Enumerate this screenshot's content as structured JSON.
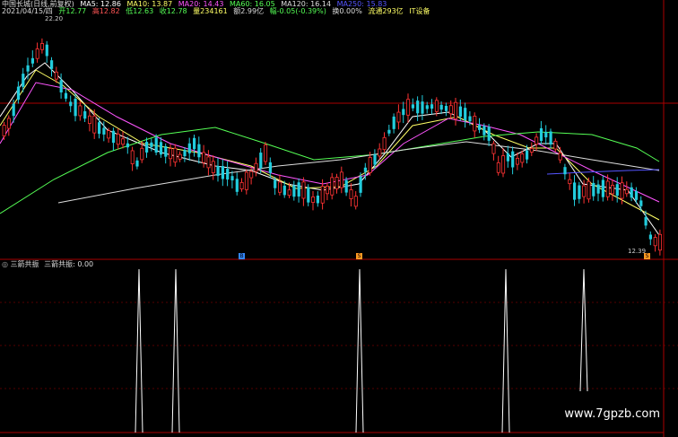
{
  "header": {
    "title": "中国长城(日线,前复权)",
    "ma": [
      {
        "label": "MA5: 12.86",
        "color": "#ffffff"
      },
      {
        "label": "MA10: 13.87",
        "color": "#ffff66"
      },
      {
        "label": "MA20: 14.43",
        "color": "#ff55ff"
      },
      {
        "label": "MA60: 16.05",
        "color": "#55ff55"
      },
      {
        "label": "MA120: 16.14",
        "color": "#dddddd"
      },
      {
        "label": "MA250: 15.83",
        "color": "#5555ff"
      }
    ],
    "info": [
      {
        "label": "2021/04/15/四",
        "color": "#dddddd"
      },
      {
        "label": "开12.77",
        "color": "#55ff55"
      },
      {
        "label": "高12.82",
        "color": "#ff5555"
      },
      {
        "label": "低12.63",
        "color": "#55ff55"
      },
      {
        "label": "收12.78",
        "color": "#55ff55"
      },
      {
        "label": "量234161",
        "color": "#ffff66"
      },
      {
        "label": "额2.99亿",
        "color": "#dddddd"
      },
      {
        "label": "幅-0.05(-0.39%)",
        "color": "#55ff55"
      },
      {
        "label": "换0.00%",
        "color": "#dddddd"
      },
      {
        "label": "流通293亿",
        "color": "#ffff66"
      },
      {
        "label": "IT设备",
        "color": "#ffff66"
      }
    ]
  },
  "price_labels": {
    "high": "22.20",
    "low": "12.39"
  },
  "markers": {
    "blue": "B",
    "orange": "S"
  },
  "sub_chart": {
    "title": "三箭共振",
    "value_label": "三箭共振: 0.00"
  },
  "watermark": "www.7gpzb.com",
  "colors": {
    "up": "#ff3333",
    "down": "#22ccdd",
    "divider": "#aa0000"
  }
}
